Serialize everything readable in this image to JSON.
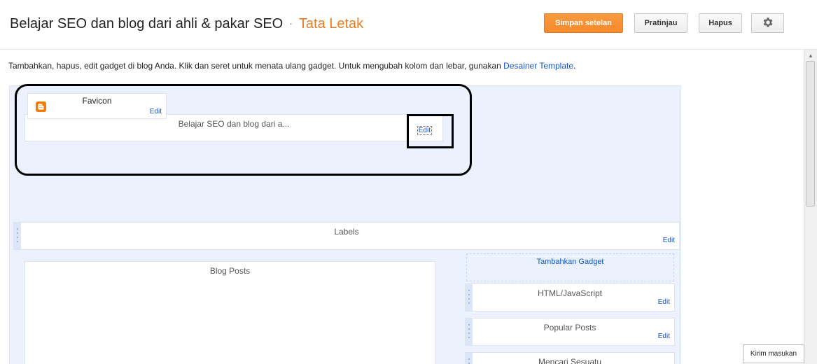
{
  "header": {
    "blog_title": "Belajar SEO dan blog dari ahli & pakar SEO",
    "separator": "·",
    "section_title": "Tata Letak",
    "buttons": {
      "save": "Simpan setelan",
      "preview": "Pratinjau",
      "delete": "Hapus",
      "settings_icon": "gear-icon"
    }
  },
  "intro": {
    "text": "Tambahkan, hapus, edit gadget di blog Anda. Klik dan seret untuk menata ulang gadget. Untuk mengubah kolom dan lebar, gunakan ",
    "link": "Desainer Template",
    "end": "."
  },
  "layout": {
    "favicon": {
      "name": "Favicon",
      "edit": "Edit",
      "icon": "blogger-icon"
    },
    "header_gadget": {
      "name": "Belajar SEO dan blog dari a...",
      "edit": "Edit"
    },
    "labels": {
      "name": "Labels",
      "edit": "Edit"
    },
    "blog_posts": {
      "name": "Blog Posts"
    },
    "sidebar": {
      "add_gadget": "Tambahkan Gadget",
      "gadgets": [
        {
          "name": "HTML/JavaScript",
          "edit": "Edit"
        },
        {
          "name": "Popular Posts",
          "edit": "Edit"
        },
        {
          "name": "Mencari Sesuatu"
        }
      ]
    }
  },
  "feedback": "Kirim masukan",
  "colors": {
    "accent": "#e67d24",
    "link": "#1155cc",
    "canvas": "#ebf2fe"
  }
}
